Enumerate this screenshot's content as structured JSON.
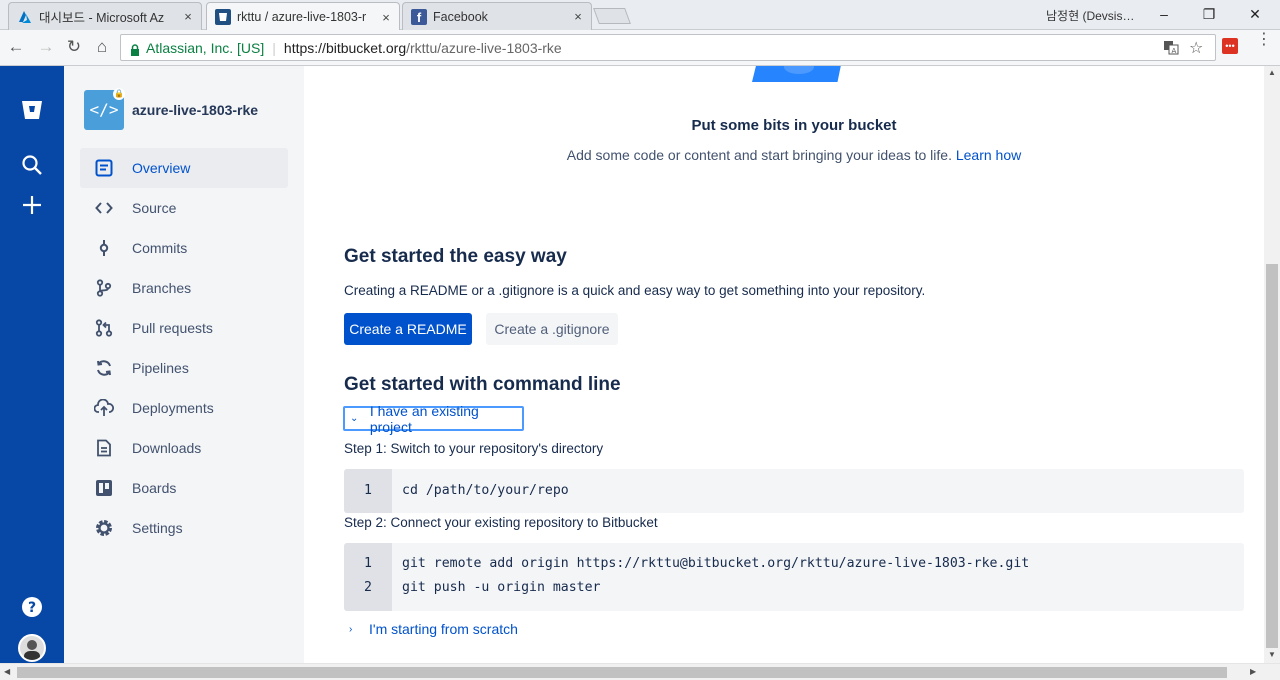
{
  "browser": {
    "tabs": [
      {
        "title": "대시보드 - Microsoft Az",
        "close": "×",
        "favicon": "azure-icon"
      },
      {
        "title": "rkttu / azure-live-1803-r",
        "close": "×",
        "favicon": "bitbucket-icon"
      },
      {
        "title": "Facebook",
        "close": "×",
        "favicon": "facebook-icon"
      }
    ],
    "profile": "남정현 (Devsis…",
    "window_buttons": {
      "minimize": "–",
      "restore": "❐",
      "close": "✕"
    },
    "nav": {
      "back": "←",
      "forward": "→",
      "reload": "↻",
      "home": "⌂"
    },
    "omnibox": {
      "secure_label": "Atlassian, Inc. [US]",
      "separator": "|",
      "url_host": "https://bitbucket.org",
      "url_path": "/rkttu/azure-live-1803-rke"
    },
    "extension_label": "•••",
    "menu_label": "⋮"
  },
  "global_nav": {
    "logo": "bitbucket-logo-icon",
    "search": "search-icon",
    "create": "plus-icon",
    "help": "help-icon",
    "avatar": "avatar-icon"
  },
  "sidebar": {
    "repo_name": "azure-live-1803-rke",
    "repo_icon": "</>",
    "items": [
      {
        "label": "Overview",
        "icon": "overview-icon",
        "selected": true
      },
      {
        "label": "Source",
        "icon": "source-icon"
      },
      {
        "label": "Commits",
        "icon": "commits-icon"
      },
      {
        "label": "Branches",
        "icon": "branches-icon"
      },
      {
        "label": "Pull requests",
        "icon": "pull-requests-icon"
      },
      {
        "label": "Pipelines",
        "icon": "pipelines-icon"
      },
      {
        "label": "Deployments",
        "icon": "deployments-icon"
      },
      {
        "label": "Downloads",
        "icon": "downloads-icon"
      },
      {
        "label": "Boards",
        "icon": "boards-icon"
      },
      {
        "label": "Settings",
        "icon": "settings-icon"
      }
    ]
  },
  "main": {
    "hero_title": "Put some bits in your bucket",
    "hero_sub": "Add some code or content and start bringing your ideas to life.",
    "hero_link": "Learn how",
    "easy_heading": "Get started the easy way",
    "easy_text": "Creating a README or a .gitignore is a quick and easy way to get something into your repository.",
    "btn_readme": "Create a README",
    "btn_gitignore": "Create a .gitignore",
    "cmd_heading": "Get started with command line",
    "existing_toggle": "I have an existing project",
    "step1": "Step 1: Switch to your repository's directory",
    "code1": [
      {
        "n": "1",
        "text": "cd /path/to/your/repo"
      }
    ],
    "step2": "Step 2: Connect your existing repository to Bitbucket",
    "code2": [
      {
        "n": "1",
        "text": "git remote add origin https://rkttu@bitbucket.org/rkttu/azure-live-1803-rke.git"
      },
      {
        "n": "2",
        "text": "git push -u origin master"
      }
    ],
    "scratch_toggle": "I'm starting from scratch"
  },
  "colors": {
    "global_nav": "#0747a6",
    "primary": "#0052cc",
    "sidebar_bg": "#f4f5f7"
  }
}
